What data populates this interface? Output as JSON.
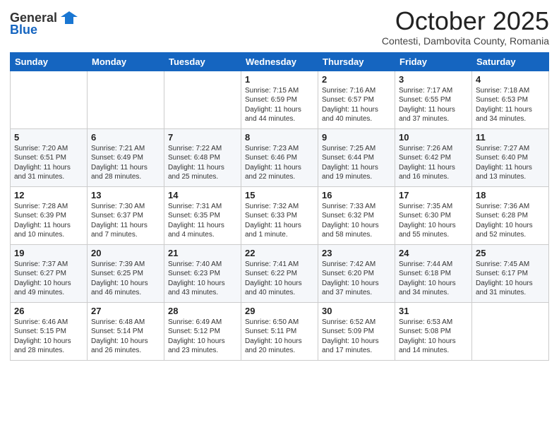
{
  "header": {
    "logo_line1": "General",
    "logo_line2": "Blue",
    "month": "October 2025",
    "location": "Contesti, Dambovita County, Romania"
  },
  "days_of_week": [
    "Sunday",
    "Monday",
    "Tuesday",
    "Wednesday",
    "Thursday",
    "Friday",
    "Saturday"
  ],
  "weeks": [
    [
      {
        "day": "",
        "info": ""
      },
      {
        "day": "",
        "info": ""
      },
      {
        "day": "",
        "info": ""
      },
      {
        "day": "1",
        "info": "Sunrise: 7:15 AM\nSunset: 6:59 PM\nDaylight: 11 hours\nand 44 minutes."
      },
      {
        "day": "2",
        "info": "Sunrise: 7:16 AM\nSunset: 6:57 PM\nDaylight: 11 hours\nand 40 minutes."
      },
      {
        "day": "3",
        "info": "Sunrise: 7:17 AM\nSunset: 6:55 PM\nDaylight: 11 hours\nand 37 minutes."
      },
      {
        "day": "4",
        "info": "Sunrise: 7:18 AM\nSunset: 6:53 PM\nDaylight: 11 hours\nand 34 minutes."
      }
    ],
    [
      {
        "day": "5",
        "info": "Sunrise: 7:20 AM\nSunset: 6:51 PM\nDaylight: 11 hours\nand 31 minutes."
      },
      {
        "day": "6",
        "info": "Sunrise: 7:21 AM\nSunset: 6:49 PM\nDaylight: 11 hours\nand 28 minutes."
      },
      {
        "day": "7",
        "info": "Sunrise: 7:22 AM\nSunset: 6:48 PM\nDaylight: 11 hours\nand 25 minutes."
      },
      {
        "day": "8",
        "info": "Sunrise: 7:23 AM\nSunset: 6:46 PM\nDaylight: 11 hours\nand 22 minutes."
      },
      {
        "day": "9",
        "info": "Sunrise: 7:25 AM\nSunset: 6:44 PM\nDaylight: 11 hours\nand 19 minutes."
      },
      {
        "day": "10",
        "info": "Sunrise: 7:26 AM\nSunset: 6:42 PM\nDaylight: 11 hours\nand 16 minutes."
      },
      {
        "day": "11",
        "info": "Sunrise: 7:27 AM\nSunset: 6:40 PM\nDaylight: 11 hours\nand 13 minutes."
      }
    ],
    [
      {
        "day": "12",
        "info": "Sunrise: 7:28 AM\nSunset: 6:39 PM\nDaylight: 11 hours\nand 10 minutes."
      },
      {
        "day": "13",
        "info": "Sunrise: 7:30 AM\nSunset: 6:37 PM\nDaylight: 11 hours\nand 7 minutes."
      },
      {
        "day": "14",
        "info": "Sunrise: 7:31 AM\nSunset: 6:35 PM\nDaylight: 11 hours\nand 4 minutes."
      },
      {
        "day": "15",
        "info": "Sunrise: 7:32 AM\nSunset: 6:33 PM\nDaylight: 11 hours\nand 1 minute."
      },
      {
        "day": "16",
        "info": "Sunrise: 7:33 AM\nSunset: 6:32 PM\nDaylight: 10 hours\nand 58 minutes."
      },
      {
        "day": "17",
        "info": "Sunrise: 7:35 AM\nSunset: 6:30 PM\nDaylight: 10 hours\nand 55 minutes."
      },
      {
        "day": "18",
        "info": "Sunrise: 7:36 AM\nSunset: 6:28 PM\nDaylight: 10 hours\nand 52 minutes."
      }
    ],
    [
      {
        "day": "19",
        "info": "Sunrise: 7:37 AM\nSunset: 6:27 PM\nDaylight: 10 hours\nand 49 minutes."
      },
      {
        "day": "20",
        "info": "Sunrise: 7:39 AM\nSunset: 6:25 PM\nDaylight: 10 hours\nand 46 minutes."
      },
      {
        "day": "21",
        "info": "Sunrise: 7:40 AM\nSunset: 6:23 PM\nDaylight: 10 hours\nand 43 minutes."
      },
      {
        "day": "22",
        "info": "Sunrise: 7:41 AM\nSunset: 6:22 PM\nDaylight: 10 hours\nand 40 minutes."
      },
      {
        "day": "23",
        "info": "Sunrise: 7:42 AM\nSunset: 6:20 PM\nDaylight: 10 hours\nand 37 minutes."
      },
      {
        "day": "24",
        "info": "Sunrise: 7:44 AM\nSunset: 6:18 PM\nDaylight: 10 hours\nand 34 minutes."
      },
      {
        "day": "25",
        "info": "Sunrise: 7:45 AM\nSunset: 6:17 PM\nDaylight: 10 hours\nand 31 minutes."
      }
    ],
    [
      {
        "day": "26",
        "info": "Sunrise: 6:46 AM\nSunset: 5:15 PM\nDaylight: 10 hours\nand 28 minutes."
      },
      {
        "day": "27",
        "info": "Sunrise: 6:48 AM\nSunset: 5:14 PM\nDaylight: 10 hours\nand 26 minutes."
      },
      {
        "day": "28",
        "info": "Sunrise: 6:49 AM\nSunset: 5:12 PM\nDaylight: 10 hours\nand 23 minutes."
      },
      {
        "day": "29",
        "info": "Sunrise: 6:50 AM\nSunset: 5:11 PM\nDaylight: 10 hours\nand 20 minutes."
      },
      {
        "day": "30",
        "info": "Sunrise: 6:52 AM\nSunset: 5:09 PM\nDaylight: 10 hours\nand 17 minutes."
      },
      {
        "day": "31",
        "info": "Sunrise: 6:53 AM\nSunset: 5:08 PM\nDaylight: 10 hours\nand 14 minutes."
      },
      {
        "day": "",
        "info": ""
      }
    ]
  ]
}
